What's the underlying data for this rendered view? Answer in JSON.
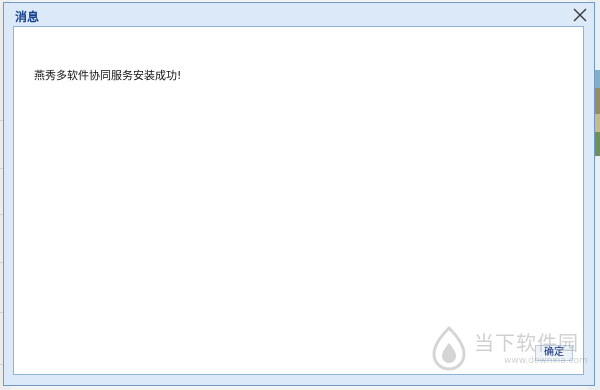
{
  "dialog": {
    "title": "消息",
    "message": "燕秀多软件协同服务安装成功!",
    "ok_label": "确定",
    "close_icon": "close-icon"
  },
  "watermark": {
    "brand": "当下软件园",
    "url": "www.downxia.com"
  },
  "colors": {
    "title_text": "#15428b",
    "frame": "#dbe9f8",
    "frame_border": "#6f99c6",
    "content_border": "#8eb2d9"
  }
}
